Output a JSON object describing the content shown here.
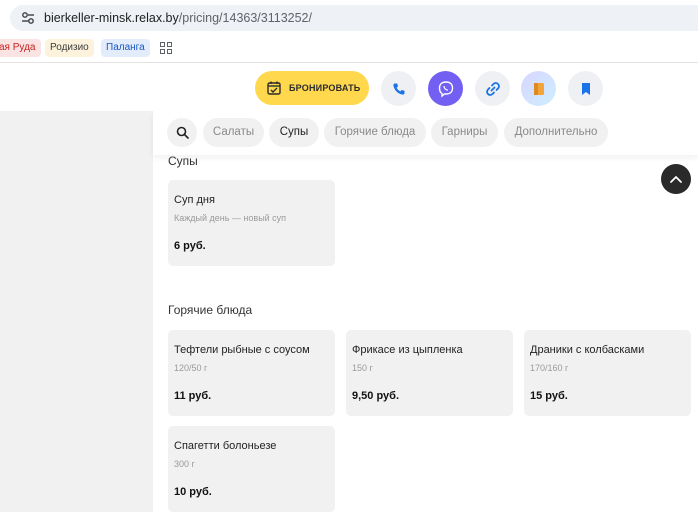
{
  "browser": {
    "url_host": "bierkeller-minsk.relax.by",
    "url_path": "/pricing/14363/3113252/",
    "bookmarks": [
      {
        "label": "ая Руда"
      },
      {
        "label": "Родизио"
      },
      {
        "label": "Паланга"
      }
    ]
  },
  "header": {
    "book_label": "БРОНИРОВАТЬ",
    "icons": [
      "phone-icon",
      "viber-icon",
      "link-icon",
      "relax-logo-icon",
      "bookmark-icon"
    ],
    "colors": {
      "book": "#ffd84d",
      "viber": "#7360f2",
      "accent_blue": "#1a73e8"
    }
  },
  "filters": {
    "items": [
      {
        "label": "Салаты",
        "active": false
      },
      {
        "label": "Супы",
        "active": true
      },
      {
        "label": "Горячие блюда",
        "active": false
      },
      {
        "label": "Гарниры",
        "active": false
      },
      {
        "label": "Дополнительно",
        "active": false
      }
    ]
  },
  "sections": [
    {
      "title": "Супы",
      "items": [
        {
          "name": "Суп дня",
          "desc": "Каждый день — новый суп",
          "price": "6 руб."
        }
      ]
    },
    {
      "title": "Горячие блюда",
      "items": [
        {
          "name": "Тефтели рыбные с соусом",
          "desc": "120/50 г",
          "price": "11 руб."
        },
        {
          "name": "Фрикасе из цыпленка",
          "desc": "150 г",
          "price": "9,50 руб."
        },
        {
          "name": "Драники с колбасками",
          "desc": "170/160 г",
          "price": "15 руб."
        },
        {
          "name": "Спагетти болоньезе",
          "desc": "300 г",
          "price": "10 руб."
        }
      ]
    }
  ]
}
